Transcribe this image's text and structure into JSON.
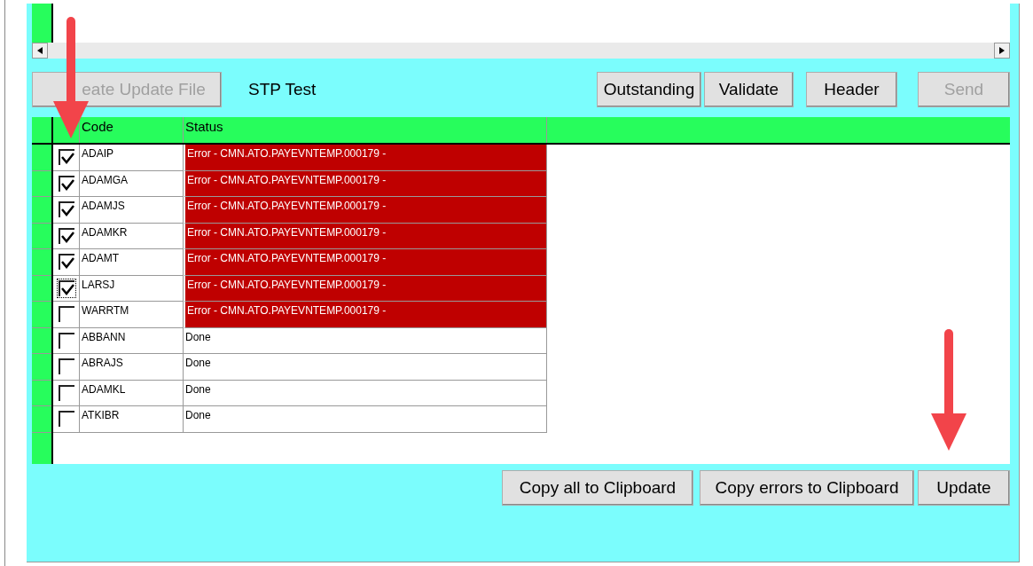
{
  "toolbar": {
    "buttons": [
      {
        "label": "eate Update File",
        "disabled": true
      }
    ],
    "label": "STP Test",
    "right_buttons": [
      {
        "label": "Outstanding",
        "disabled": false
      },
      {
        "label": "Validate",
        "disabled": false
      },
      {
        "label": "Header",
        "disabled": false
      },
      {
        "label": "Send",
        "disabled": true
      }
    ]
  },
  "table": {
    "columns": [
      "Code",
      "Status"
    ],
    "rows": [
      {
        "checked": true,
        "focused": false,
        "code": "ADAIP",
        "status": "Error - CMN.ATO.PAYEVNTEMP.000179 -",
        "kind": "error"
      },
      {
        "checked": true,
        "focused": false,
        "code": "ADAMGA",
        "status": "Error - CMN.ATO.PAYEVNTEMP.000179 -",
        "kind": "error"
      },
      {
        "checked": true,
        "focused": false,
        "code": "ADAMJS",
        "status": "Error - CMN.ATO.PAYEVNTEMP.000179 -",
        "kind": "error"
      },
      {
        "checked": true,
        "focused": false,
        "code": "ADAMKR",
        "status": "Error - CMN.ATO.PAYEVNTEMP.000179 -",
        "kind": "error"
      },
      {
        "checked": true,
        "focused": false,
        "code": "ADAMT",
        "status": "Error - CMN.ATO.PAYEVNTEMP.000179 -",
        "kind": "error"
      },
      {
        "checked": true,
        "focused": true,
        "code": "LARSJ",
        "status": "Error - CMN.ATO.PAYEVNTEMP.000179 -",
        "kind": "error"
      },
      {
        "checked": false,
        "focused": false,
        "code": "WARRTM",
        "status": "Error - CMN.ATO.PAYEVNTEMP.000179 -",
        "kind": "error"
      },
      {
        "checked": false,
        "focused": false,
        "code": "ABBANN",
        "status": "Done",
        "kind": "done"
      },
      {
        "checked": false,
        "focused": false,
        "code": "ABRAJS",
        "status": "Done",
        "kind": "done"
      },
      {
        "checked": false,
        "focused": false,
        "code": "ADAMKL",
        "status": "Done",
        "kind": "done"
      },
      {
        "checked": false,
        "focused": false,
        "code": "ATKIBR",
        "status": "Done",
        "kind": "done"
      }
    ]
  },
  "bottom_buttons": [
    {
      "label": "Copy all to Clipboard"
    },
    {
      "label": "Copy errors to Clipboard"
    },
    {
      "label": "Update"
    }
  ]
}
